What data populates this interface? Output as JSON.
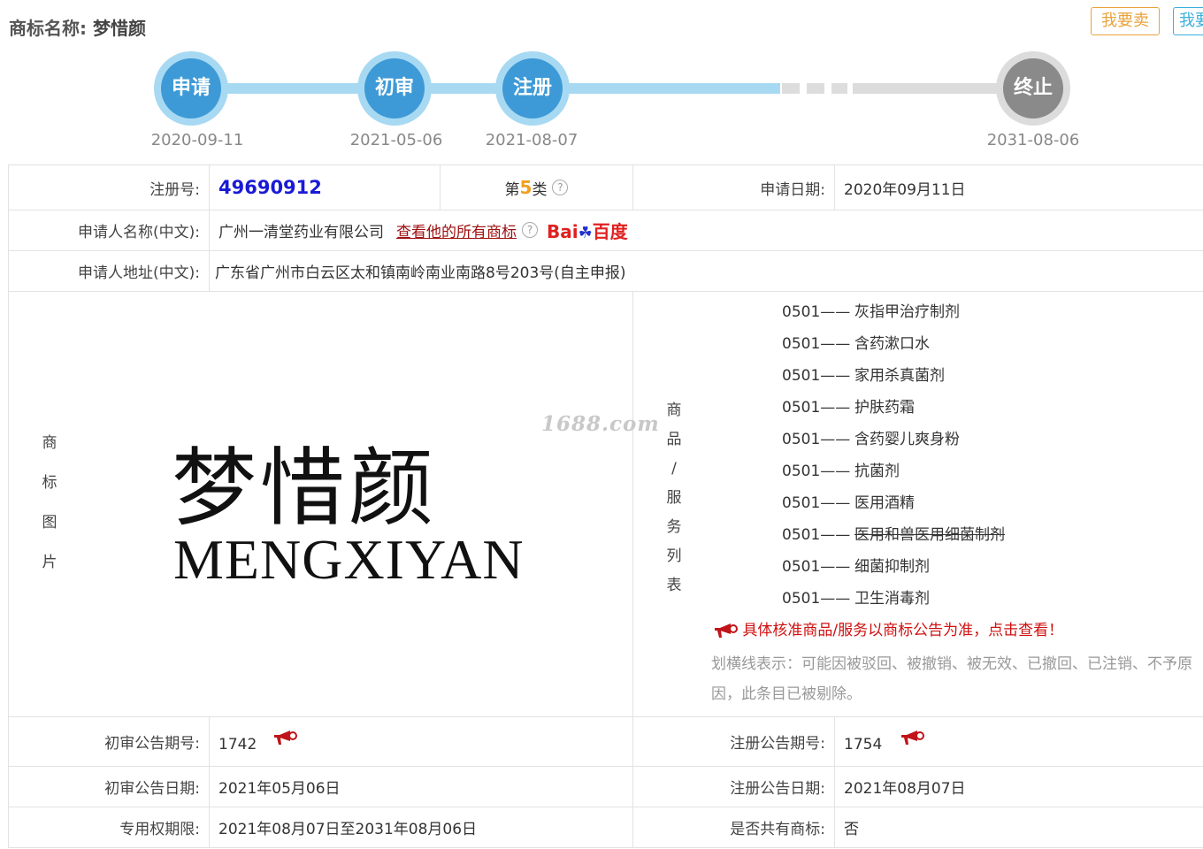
{
  "header": {
    "title_label": "商标名称:",
    "title_name": "梦惜颜",
    "sell_button": "我要卖",
    "buy_button": "我要"
  },
  "timeline": [
    {
      "label": "申请",
      "date": "2020-09-11"
    },
    {
      "label": "初审",
      "date": "2021-05-06"
    },
    {
      "label": "注册",
      "date": "2021-08-07"
    },
    {
      "label": "终止",
      "date": "2031-08-06"
    }
  ],
  "info": {
    "reg_no_label": "注册号:",
    "reg_no": "49690912",
    "class_prefix": "第",
    "class_num": "5",
    "class_suffix": "类",
    "apply_date_label": "申请日期:",
    "apply_date": "2020年09月11日",
    "applicant_label": "申请人名称(中文):",
    "applicant": "广州一清堂药业有限公司",
    "all_marks_link": "查看他的所有商标",
    "baidu_text": "Bai",
    "baidu_cn": "百度",
    "address_label": "申请人地址(中文):",
    "address": "广东省广州市白云区太和镇南岭南业南路8号203号(自主申报)",
    "image_label": "商标图片",
    "mark_cn": "梦惜颜",
    "mark_en": "MENGXIYAN",
    "watermark": "1688.com",
    "goods_label": "商品/服务列表",
    "prelim_no_label": "初审公告期号:",
    "prelim_no": "1742",
    "reg_pub_no_label": "注册公告期号:",
    "reg_pub_no": "1754",
    "prelim_date_label": "初审公告日期:",
    "prelim_date": "2021年05月06日",
    "reg_pub_date_label": "注册公告日期:",
    "reg_pub_date": "2021年08月07日",
    "term_label": "专用权期限:",
    "term": "2021年08月07日至2031年08月06日",
    "shared_label": "是否共有商标:",
    "shared": "否"
  },
  "goods": [
    {
      "code": "0501——",
      "name": "灰指甲治疗制剂",
      "struck": false
    },
    {
      "code": "0501——",
      "name": "含药漱口水",
      "struck": false
    },
    {
      "code": "0501——",
      "name": "家用杀真菌剂",
      "struck": false
    },
    {
      "code": "0501——",
      "name": "护肤药霜",
      "struck": false
    },
    {
      "code": "0501——",
      "name": "含药婴儿爽身粉",
      "struck": false
    },
    {
      "code": "0501——",
      "name": "抗菌剂",
      "struck": false
    },
    {
      "code": "0501——",
      "name": "医用酒精",
      "struck": false
    },
    {
      "code": "0501——",
      "name": "医用和兽医用细菌制剂",
      "struck": true
    },
    {
      "code": "0501——",
      "name": "细菌抑制剂",
      "struck": false
    },
    {
      "code": "0501——",
      "name": "卫生消毒剂",
      "struck": false
    }
  ],
  "notice": "具体核准商品/服务以商标公告为准，点击查看！",
  "strike_note": "划横线表示：可能因被驳回、被撤销、被无效、已撤回、已注销、不予原因，此条目已被剔除。",
  "colors": {
    "accent_blue": "#3d9ad6",
    "link_red": "#a01010",
    "notice_red": "#d01010",
    "reg_no_blue": "#1a1ad6"
  }
}
